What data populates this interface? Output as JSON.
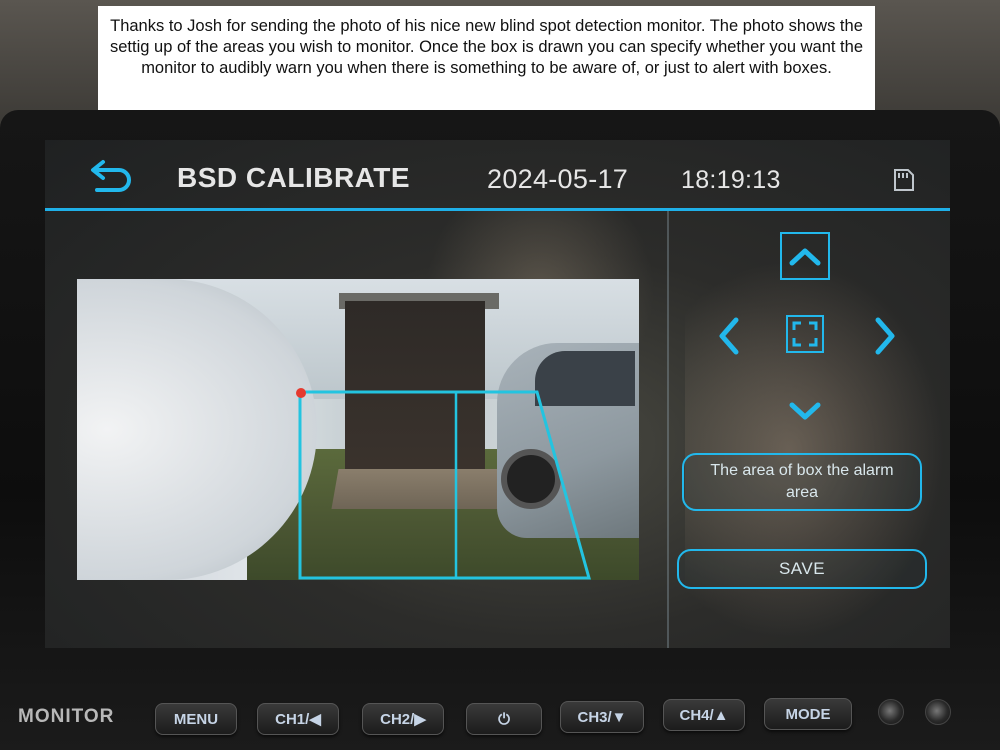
{
  "caption": {
    "text": "Thanks to Josh for sending the photo of his nice new blind spot detection monitor. The photo shows the settig up of the areas you wish to monitor. Once the box is drawn you can specify whether you want the monitor to audibly warn you when there is something to be aware of, or just to alert with boxes."
  },
  "header": {
    "title": "BSD CALIBRATE",
    "date": "2024-05-17",
    "time": "18:19:13",
    "back_icon": "back-arrow-icon",
    "storage_icon": "sd-card-icon"
  },
  "controls": {
    "up_icon": "chevron-up-icon",
    "down_icon": "chevron-down-icon",
    "left_icon": "chevron-left-icon",
    "right_icon": "chevron-right-icon",
    "center_icon": "resize-box-icon",
    "info_text": "The area of box the alarm area",
    "save_label": "SAVE"
  },
  "hardware": {
    "brand": "MONITOR",
    "buttons": [
      "MENU",
      "CH1/◀",
      "CH2/▶",
      "⏻",
      "CH3/▼",
      "CH4/▲",
      "MODE"
    ]
  },
  "colors": {
    "accent": "#22b8ec",
    "zone": "#23c4e0",
    "marker": "#e53a2f"
  }
}
